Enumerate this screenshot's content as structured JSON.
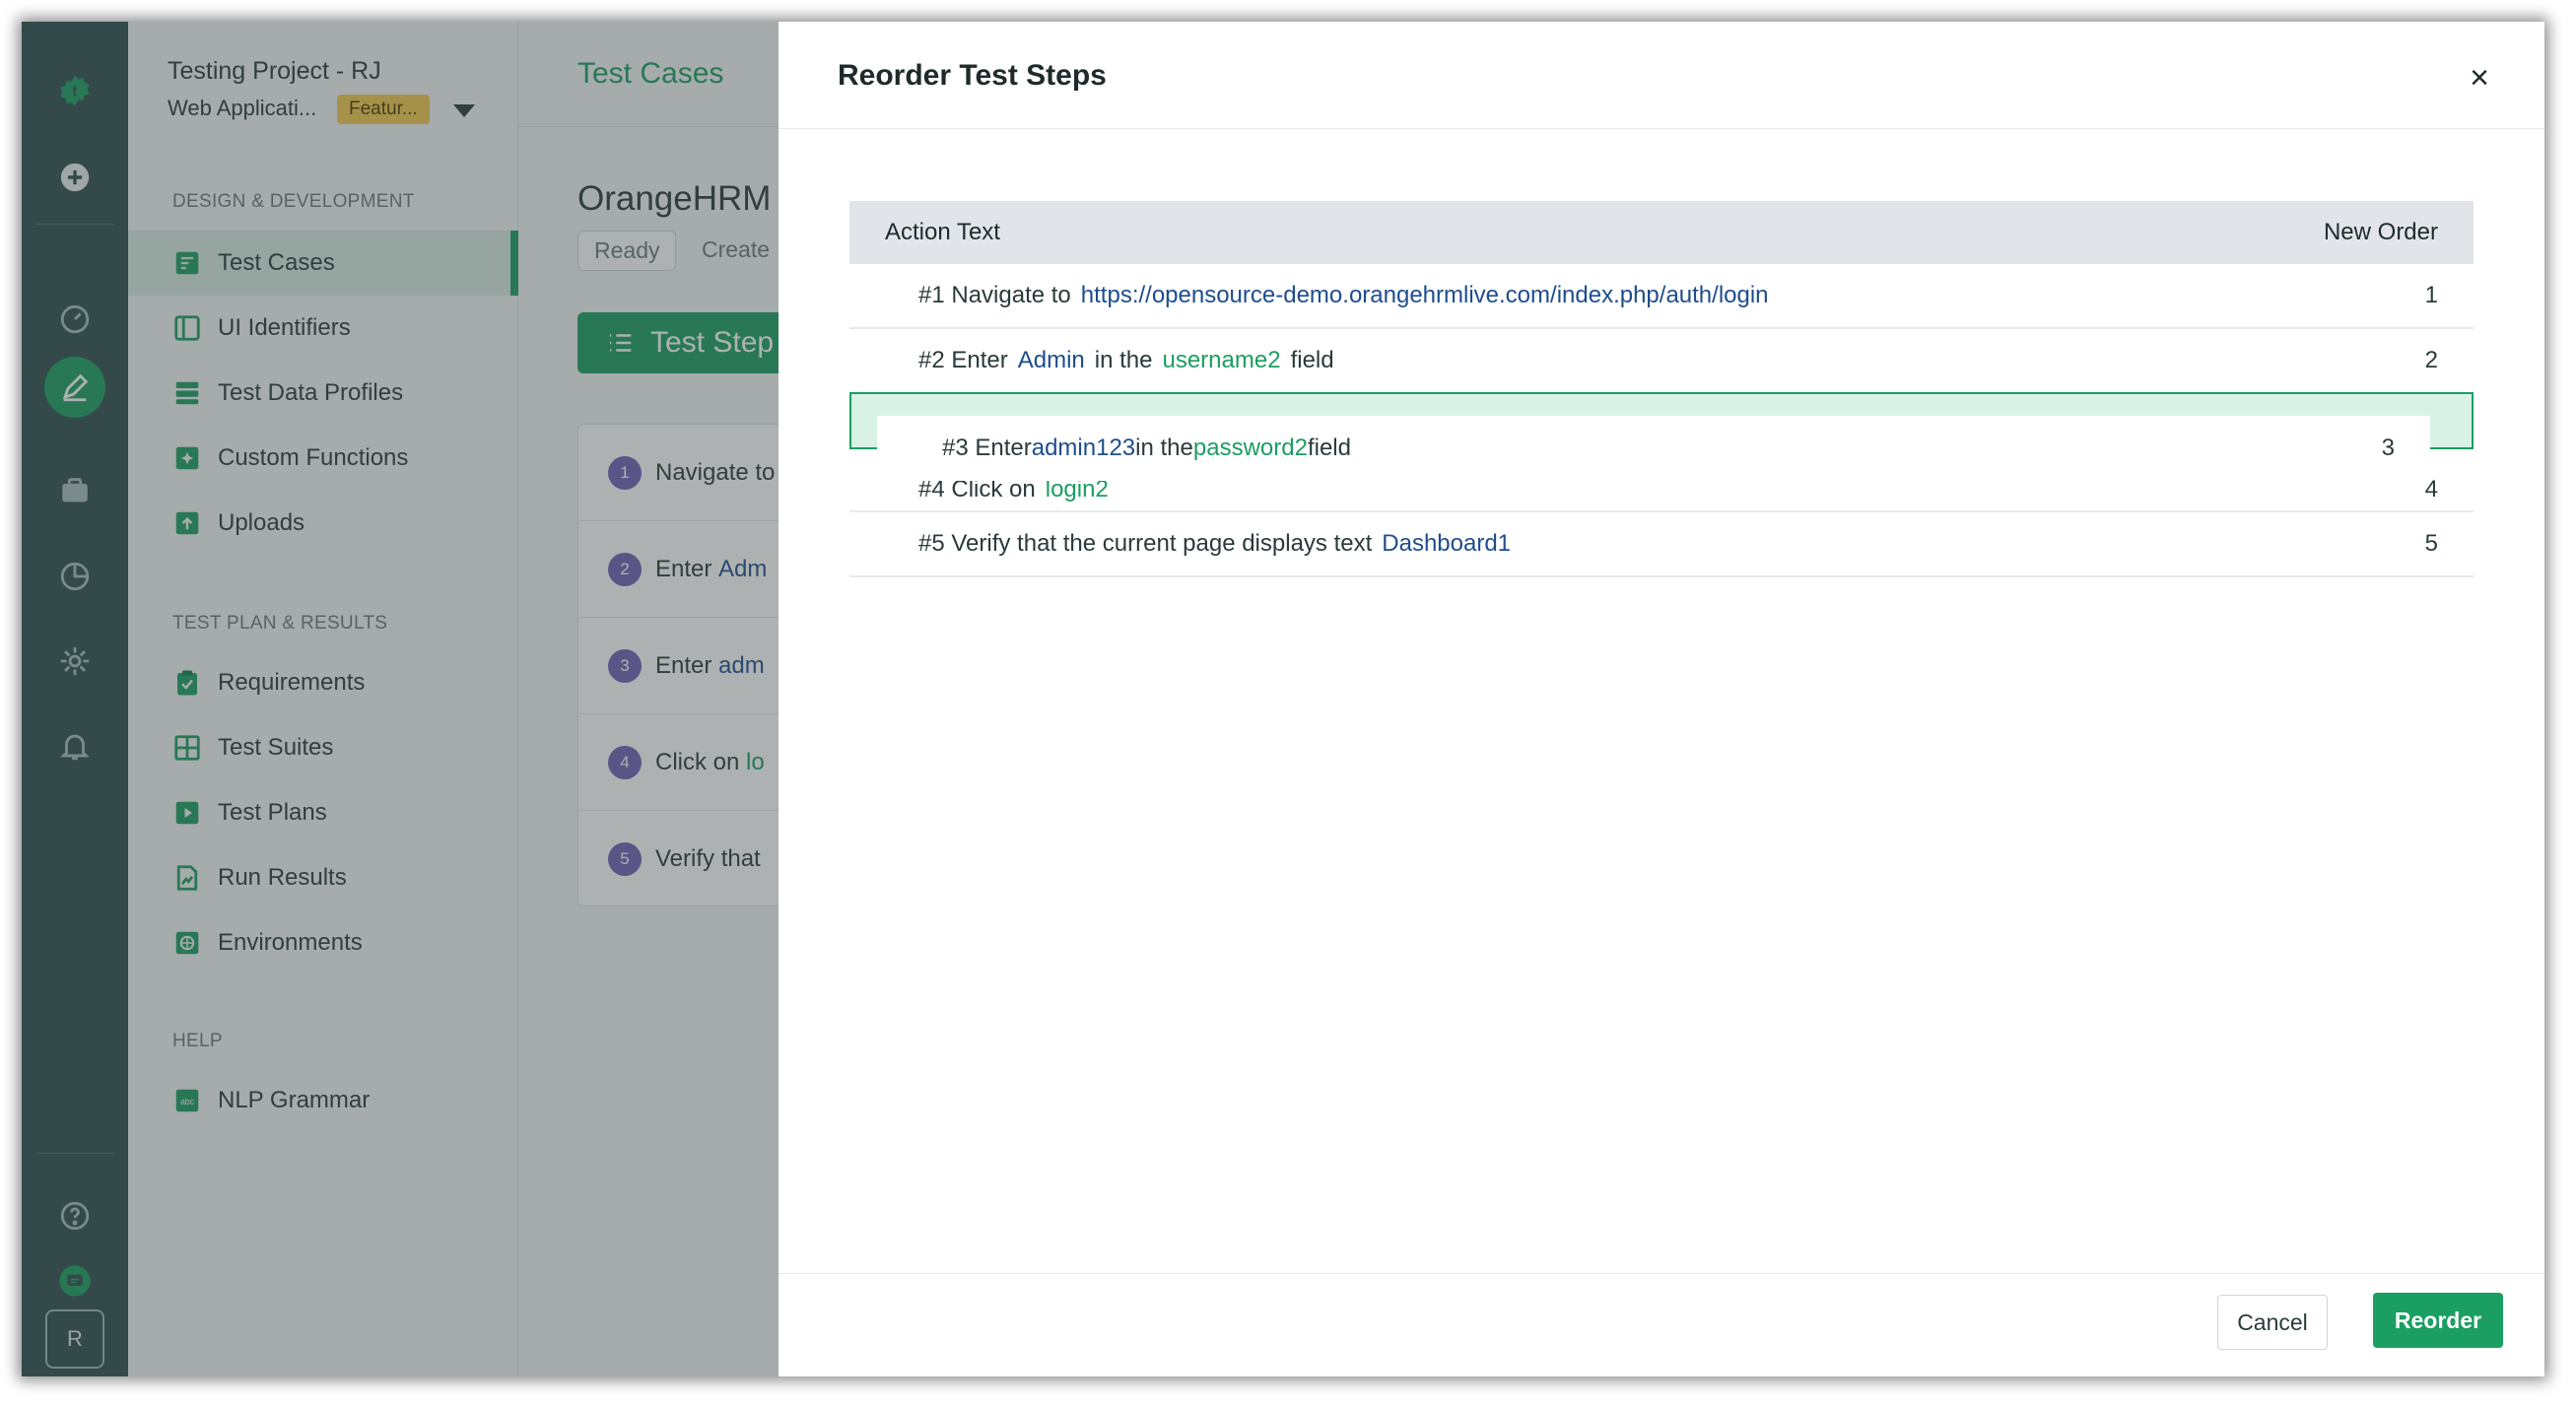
{
  "rail": {
    "icons": [
      "logo-icon",
      "add-icon",
      "dashboard-icon",
      "edit-icon",
      "briefcase-icon",
      "reports-icon",
      "settings-icon",
      "bell-icon",
      "help-icon",
      "chat-icon"
    ],
    "avatar_letter": "R"
  },
  "sidebar": {
    "project_name": "Testing Project - RJ",
    "app_name": "Web Applicati...",
    "branch_badge": "Featur...",
    "section_design": "DESIGN & DEVELOPMENT",
    "design_items": [
      {
        "label": "Test Cases",
        "icon": "test-cases-icon",
        "active": true
      },
      {
        "label": "UI Identifiers",
        "icon": "ui-identifiers-icon"
      },
      {
        "label": "Test Data Profiles",
        "icon": "test-data-icon"
      },
      {
        "label": "Custom Functions",
        "icon": "custom-functions-icon"
      },
      {
        "label": "Uploads",
        "icon": "uploads-icon"
      }
    ],
    "section_plan": "TEST PLAN & RESULTS",
    "plan_items": [
      {
        "label": "Requirements",
        "icon": "requirements-icon"
      },
      {
        "label": "Test Suites",
        "icon": "test-suites-icon"
      },
      {
        "label": "Test Plans",
        "icon": "test-plans-icon"
      },
      {
        "label": "Run Results",
        "icon": "run-results-icon"
      },
      {
        "label": "Environments",
        "icon": "environments-icon"
      }
    ],
    "section_help": "HELP",
    "help_items": [
      {
        "label": "NLP Grammar",
        "icon": "nlp-grammar-icon"
      }
    ]
  },
  "main": {
    "breadcrumb": "Test Cases",
    "breadcrumb_sep": "❯",
    "title": "OrangeHRM",
    "status_pill": "Ready",
    "created_pill": "Create",
    "steps_button": "Test Step",
    "steps": [
      {
        "num": "1",
        "text": "Navigate to"
      },
      {
        "num": "2",
        "text": "Enter",
        "value": "Adm"
      },
      {
        "num": "3",
        "text": "Enter",
        "value": "adm"
      },
      {
        "num": "4",
        "text": "Click on",
        "value": "lo"
      },
      {
        "num": "5",
        "text": "Verify that"
      }
    ]
  },
  "modal": {
    "title": "Reorder Test Steps",
    "close": "×",
    "col_action": "Action Text",
    "col_order": "New Order",
    "rows": [
      {
        "prefix": "#1 Navigate to",
        "v1": "https://opensource-demo.orangehrmlive.com/index.php/auth/login",
        "order": "1"
      },
      {
        "prefix": "#2 Enter",
        "v1": "Admin",
        "mid": "in the",
        "v2": "username2",
        "suffix": "field",
        "order": "2"
      },
      {
        "prefix": "#4 Click on",
        "v1": "login2",
        "order": "4"
      },
      {
        "prefix": "#5 Verify that the current page displays text",
        "v1": "Dashboard1",
        "order": "5"
      }
    ],
    "dragging": {
      "prefix": "#3 Enter",
      "v1": "admin123",
      "mid": "in the",
      "v2": "password2",
      "suffix": "field",
      "order": "3"
    },
    "cancel": "Cancel",
    "reorder": "Reorder"
  }
}
